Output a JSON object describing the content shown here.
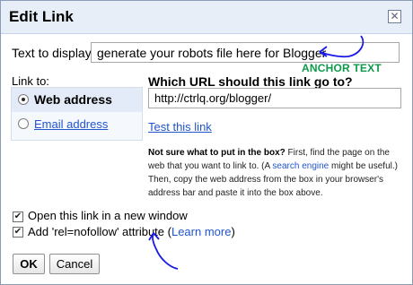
{
  "dialog": {
    "title": "Edit Link",
    "close_icon": "close-icon"
  },
  "display": {
    "label": "Text to display:",
    "value": "generate your robots file here for Blogger"
  },
  "annotation": {
    "anchor_text": "ANCHOR TEXT"
  },
  "link_to": {
    "label": "Link to:",
    "options": [
      {
        "label": "Web address",
        "selected": true
      },
      {
        "label": "Email address",
        "selected": false
      }
    ]
  },
  "url": {
    "heading": "Which URL should this link go to?",
    "value": "http://ctrlq.org/blogger/",
    "test_link": "Test this link"
  },
  "help": {
    "bold": "Not sure what to put in the box?",
    "part1": " First, find the page on the web that you want to link to. (A ",
    "link": "search engine",
    "part2": " might be useful.) Then, copy the web address from the box in your browser's address bar and paste it into the box above."
  },
  "options": {
    "new_window": {
      "label": "Open this link in a new window",
      "checked": true
    },
    "nofollow": {
      "label": "Add 'rel=nofollow' attribute (",
      "link": "Learn more",
      "after": ")",
      "checked": true
    }
  },
  "buttons": {
    "ok": "OK",
    "cancel": "Cancel"
  },
  "colors": {
    "annotation_blue": "#1a1ae6",
    "annotation_green": "#0c9b4a",
    "link_blue": "#2255cc"
  }
}
